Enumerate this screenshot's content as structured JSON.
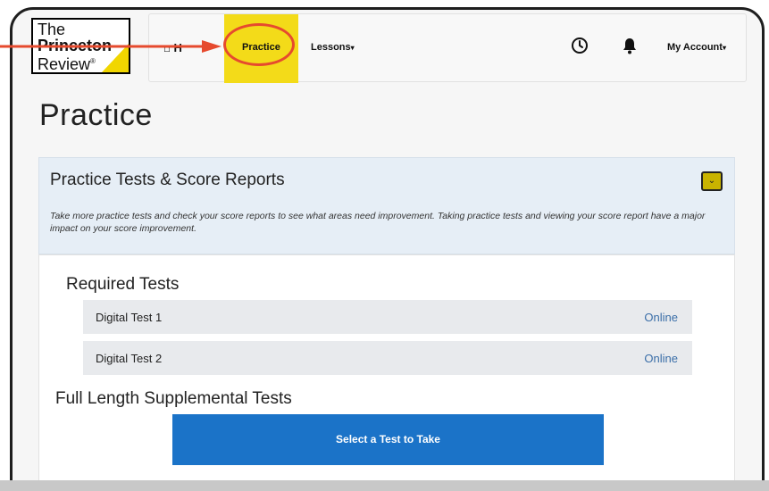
{
  "logo": {
    "line1": "The",
    "line2": "Princeton",
    "line3": "Review",
    "reg": "®"
  },
  "nav": {
    "home_label": "⌂ H",
    "practice_label": "Practice",
    "lessons_label": "Lessons",
    "account_label": "My Account",
    "clock_icon": "clock-icon",
    "bell_icon": "bell-icon"
  },
  "page_title": "Practice",
  "accordion": {
    "title": "Practice Tests & Score Reports",
    "description": "Take more practice tests and check your score reports to see what areas need improvement. Taking practice tests and viewing your score report have a major impact on your score improvement.",
    "toggle_glyph": "⌄"
  },
  "required_tests": {
    "heading": "Required Tests",
    "items": [
      {
        "name": "Digital Test 1",
        "status": "Online"
      },
      {
        "name": "Digital Test 2",
        "status": "Online"
      }
    ]
  },
  "supplemental": {
    "heading": "Full Length Supplemental Tests",
    "button_label": "Select a Test to Take"
  },
  "colors": {
    "accent_yellow": "#f3db19",
    "annotation_red": "#e64a2e",
    "primary_blue": "#1b73c8",
    "link_blue": "#3a6ea8"
  }
}
